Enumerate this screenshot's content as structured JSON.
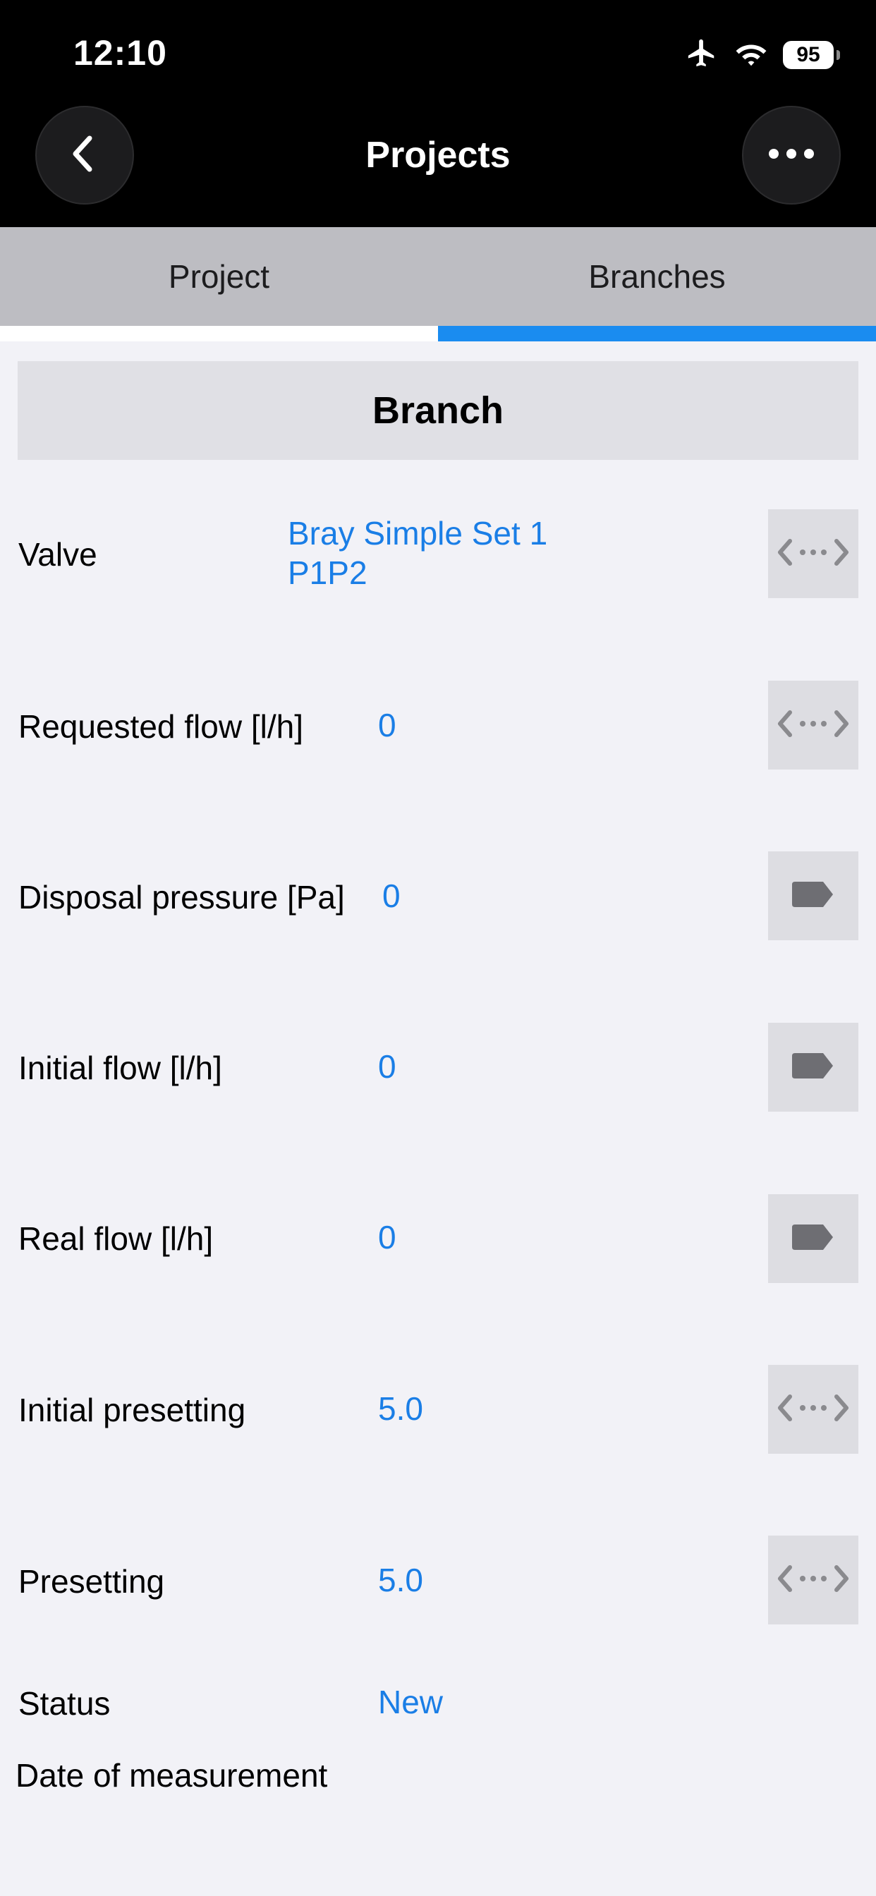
{
  "status_bar": {
    "time": "12:10",
    "battery": "95",
    "icons": [
      "airplane-icon",
      "wifi-icon",
      "battery-icon"
    ]
  },
  "nav": {
    "title": "Projects",
    "back_icon": "chevron-left-icon",
    "more_icon": "ellipsis-icon"
  },
  "tabs": [
    {
      "label": "Project",
      "active": false
    },
    {
      "label": "Branches",
      "active": true
    }
  ],
  "section": {
    "title": "Branch"
  },
  "rows": [
    {
      "label": "Valve",
      "value_line1": "Bray Simple Set 1",
      "value_line2": "P1P2",
      "icon": "connector-arrows-icon"
    },
    {
      "label": "Requested flow [l/h]",
      "value": "0",
      "icon": "connector-arrows-icon"
    },
    {
      "label": "Disposal pressure [Pa]",
      "value": "0",
      "icon": "tag-icon"
    },
    {
      "label": "Initial flow [l/h]",
      "value": "0",
      "icon": "tag-icon"
    },
    {
      "label": "Real flow [l/h]",
      "value": "0",
      "icon": "tag-icon"
    },
    {
      "label": "Initial presetting",
      "value": "5.0",
      "icon": "connector-arrows-icon"
    },
    {
      "label": "Presetting",
      "value": "5.0",
      "icon": "connector-arrows-icon"
    },
    {
      "label": "Status",
      "value": "New"
    },
    {
      "label": "Date of measurement",
      "value": ""
    }
  ],
  "colors": {
    "accent": "#1a8cf0",
    "value_text": "#1a7ee6",
    "background": "#f2f2f7",
    "header_bg": "#000000",
    "tab_bg": "#bdbdc2"
  }
}
